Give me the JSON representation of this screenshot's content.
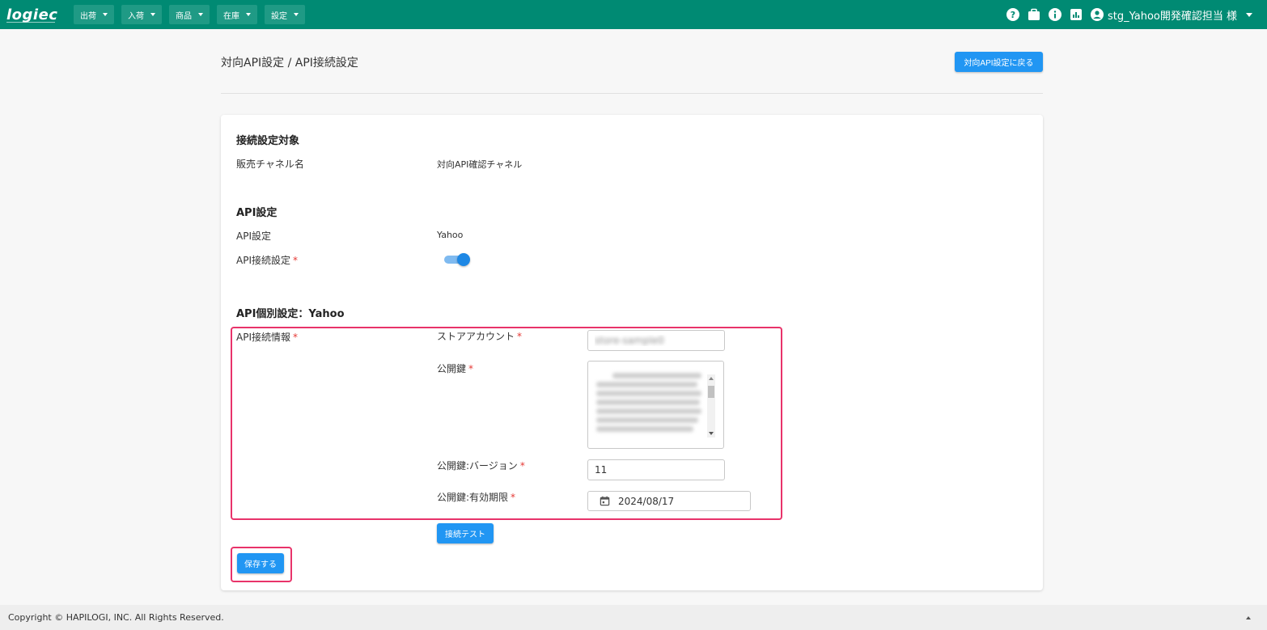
{
  "header": {
    "logo": "logiec",
    "nav": [
      {
        "label": "出荷"
      },
      {
        "label": "入荷"
      },
      {
        "label": "商品"
      },
      {
        "label": "在庫"
      },
      {
        "label": "設定"
      }
    ],
    "icons": [
      "help-icon",
      "briefcase-icon",
      "info-icon",
      "chart-icon",
      "account-icon"
    ],
    "user_name": "stg_Yahoo開発確認担当 様"
  },
  "page": {
    "title": "対向API設定 / API接続設定",
    "back_button": "対向API設定に戻る"
  },
  "target_section": {
    "title": "接続設定対象",
    "channel_label": "販売チャネル名",
    "channel_value": "対向API確認チャネル"
  },
  "api_section": {
    "title": "API設定",
    "api_label": "API設定",
    "api_value": "Yahoo",
    "connect_label": "API接続設定",
    "required_mark": "*",
    "connect_enabled": true
  },
  "individual_section": {
    "title": "API個別設定：Yahoo",
    "info_label": "API接続情報",
    "store_account_label": "ストアアカウント",
    "store_account_value": "store-sample0",
    "public_key_label": "公開鍵",
    "public_key_version_label": "公開鍵:バージョン",
    "public_key_version_value": "11",
    "public_key_expiry_label": "公開鍵:有効期限",
    "public_key_expiry_value": "2024/08/17",
    "test_button": "接続テスト"
  },
  "save_button": "保存する",
  "footer": {
    "copyright": "Copyright © HAPILOGI, INC. All Rights Reserved."
  },
  "colors": {
    "topbar": "#008a73",
    "primary_button": "#2196f3",
    "highlight": "#e8336a",
    "required": "#e53935"
  }
}
